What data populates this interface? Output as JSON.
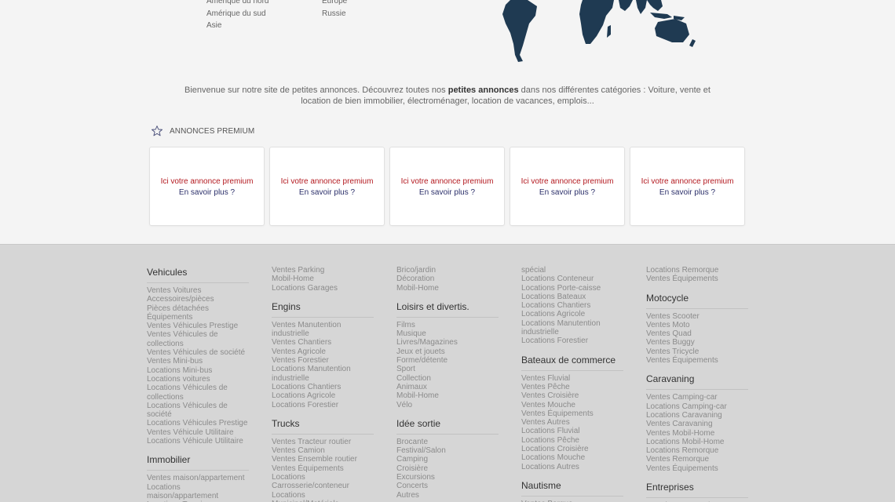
{
  "regions": {
    "col1": [
      "Amérique du nord",
      "Amérique du sud",
      "Asie"
    ],
    "col2": [
      "Europe",
      "Russie"
    ]
  },
  "map": {
    "color": "#1f3a52"
  },
  "welcome": {
    "before": "Bienvenue sur notre site de petites annonces. Découvrez toutes nos ",
    "bold": "petites annonces",
    "after": " dans nos différentes catégories : Voiture, vente et location de bien immobilier, électroménager, location de vacances, emplois..."
  },
  "premium": {
    "title": "ANNONCES PREMIUM",
    "cards": [
      {
        "line1": "Ici votre annonce premium",
        "line2": "En savoir plus ?"
      },
      {
        "line1": "Ici votre annonce premium",
        "line2": "En savoir plus ?"
      },
      {
        "line1": "Ici votre annonce premium",
        "line2": "En savoir plus ?"
      },
      {
        "line1": "Ici votre annonce premium",
        "line2": "En savoir plus ?"
      },
      {
        "line1": "Ici votre annonce premium",
        "line2": "En savoir plus ?"
      }
    ]
  },
  "footer": {
    "columns": [
      [
        {
          "type": "h",
          "text": "Vehicules"
        },
        {
          "type": "i",
          "text": "Ventes Voitures"
        },
        {
          "type": "i",
          "text": "Accessoires/pièces"
        },
        {
          "type": "i",
          "text": "Pièces détachées"
        },
        {
          "type": "i",
          "text": "Équipements"
        },
        {
          "type": "i",
          "text": "Ventes Véhicules Prestige"
        },
        {
          "type": "i",
          "text": "Ventes Véhicules de"
        },
        {
          "type": "i",
          "text": "collections"
        },
        {
          "type": "i",
          "text": "Ventes Véhicules de société"
        },
        {
          "type": "i",
          "text": "Ventes Mini-bus"
        },
        {
          "type": "i",
          "text": "Locations Mini-bus"
        },
        {
          "type": "i",
          "text": "Locations voitures"
        },
        {
          "type": "i",
          "text": "Locations Véhicules de"
        },
        {
          "type": "i",
          "text": "collections"
        },
        {
          "type": "i",
          "text": "Locations Véhicules de société"
        },
        {
          "type": "i",
          "text": "Locations Véhicules Prestige"
        },
        {
          "type": "i",
          "text": "Ventes Véhicule Utilitaire"
        },
        {
          "type": "i",
          "text": "Locations Véhicule Utilitaire"
        },
        {
          "type": "h",
          "text": "Immobilier"
        },
        {
          "type": "i",
          "text": "Ventes maison/appartement"
        },
        {
          "type": "i",
          "text": "Locations"
        },
        {
          "type": "i",
          "text": "maison/appartement"
        },
        {
          "type": "i",
          "text": "Locations Terrains"
        },
        {
          "type": "i",
          "text": "Locations de vacances"
        }
      ],
      [
        {
          "type": "i",
          "text": "Ventes Parking"
        },
        {
          "type": "i",
          "text": "Mobil-Home"
        },
        {
          "type": "i",
          "text": "Locations Garages"
        },
        {
          "type": "h",
          "text": "Engins"
        },
        {
          "type": "i",
          "text": "Ventes Manutention"
        },
        {
          "type": "i",
          "text": "industrielle"
        },
        {
          "type": "i",
          "text": "Ventes Chantiers"
        },
        {
          "type": "i",
          "text": "Ventes Agricole"
        },
        {
          "type": "i",
          "text": "Ventes Forestier"
        },
        {
          "type": "i",
          "text": "Locations Manutention"
        },
        {
          "type": "i",
          "text": "industrielle"
        },
        {
          "type": "i",
          "text": "Locations Chantiers"
        },
        {
          "type": "i",
          "text": "Locations Agricole"
        },
        {
          "type": "i",
          "text": "Locations Forestier"
        },
        {
          "type": "h",
          "text": "Trucks"
        },
        {
          "type": "i",
          "text": "Ventes Tracteur routier"
        },
        {
          "type": "i",
          "text": "Ventes Camion"
        },
        {
          "type": "i",
          "text": "Ventes Ensemble routier"
        },
        {
          "type": "i",
          "text": "Ventes Équipements"
        },
        {
          "type": "i",
          "text": "Locations"
        },
        {
          "type": "i",
          "text": "Carrosserie/conteneur"
        },
        {
          "type": "i",
          "text": "Locations Municipal/Matériels"
        },
        {
          "type": "i",
          "text": "spécial"
        }
      ],
      [
        {
          "type": "i",
          "text": "Brico/jardin"
        },
        {
          "type": "i",
          "text": "Décoration"
        },
        {
          "type": "i",
          "text": "Mobil-Home"
        },
        {
          "type": "h",
          "text": "Loisirs et divertis."
        },
        {
          "type": "i",
          "text": "Films"
        },
        {
          "type": "i",
          "text": "Musique"
        },
        {
          "type": "i",
          "text": "Livres/Magazines"
        },
        {
          "type": "i",
          "text": "Jeux et jouets"
        },
        {
          "type": "i",
          "text": "Forme/détente"
        },
        {
          "type": "i",
          "text": "Sport"
        },
        {
          "type": "i",
          "text": "Collection"
        },
        {
          "type": "i",
          "text": "Animaux"
        },
        {
          "type": "i",
          "text": "Mobil-Home"
        },
        {
          "type": "i",
          "text": "Vélo"
        },
        {
          "type": "h",
          "text": "Idée sortie"
        },
        {
          "type": "i",
          "text": "Brocante"
        },
        {
          "type": "i",
          "text": "Festival/Salon"
        },
        {
          "type": "i",
          "text": "Camping"
        },
        {
          "type": "i",
          "text": "Croisière"
        },
        {
          "type": "i",
          "text": "Excursions"
        },
        {
          "type": "i",
          "text": "Concerts"
        },
        {
          "type": "i",
          "text": "Autres"
        }
      ],
      [
        {
          "type": "i",
          "text": "spécial"
        },
        {
          "type": "i",
          "text": "Locations Conteneur"
        },
        {
          "type": "i",
          "text": "Locations Porte-caisse"
        },
        {
          "type": "i",
          "text": "Locations Bateaux"
        },
        {
          "type": "i",
          "text": "Locations Chantiers"
        },
        {
          "type": "i",
          "text": "Locations Agricole"
        },
        {
          "type": "i",
          "text": "Locations Manutention"
        },
        {
          "type": "i",
          "text": "industrielle"
        },
        {
          "type": "i",
          "text": "Locations Forestier"
        },
        {
          "type": "h",
          "text": "Bateaux de commerce"
        },
        {
          "type": "i",
          "text": "Ventes Fluvial"
        },
        {
          "type": "i",
          "text": "Ventes Pêche"
        },
        {
          "type": "i",
          "text": "Ventes Croisière"
        },
        {
          "type": "i",
          "text": "Ventes Mouche"
        },
        {
          "type": "i",
          "text": "Ventes Équipements"
        },
        {
          "type": "i",
          "text": "Ventes Autres"
        },
        {
          "type": "i",
          "text": "Locations Fluvial"
        },
        {
          "type": "i",
          "text": "Locations Pêche"
        },
        {
          "type": "i",
          "text": "Locations Croisière"
        },
        {
          "type": "i",
          "text": "Locations Mouche"
        },
        {
          "type": "i",
          "text": "Locations Autres"
        },
        {
          "type": "h",
          "text": "Nautisme"
        },
        {
          "type": "i",
          "text": "Ventes Barque"
        }
      ],
      [
        {
          "type": "i",
          "text": "Locations Remorque"
        },
        {
          "type": "i",
          "text": "Ventes Équipements"
        },
        {
          "type": "h",
          "text": "Motocycle"
        },
        {
          "type": "i",
          "text": "Ventes Scooter"
        },
        {
          "type": "i",
          "text": "Ventes Moto"
        },
        {
          "type": "i",
          "text": "Ventes Quad"
        },
        {
          "type": "i",
          "text": "Ventes Buggy"
        },
        {
          "type": "i",
          "text": "Ventes Tricycle"
        },
        {
          "type": "i",
          "text": "Ventes Équipements"
        },
        {
          "type": "h",
          "text": "Caravaning"
        },
        {
          "type": "i",
          "text": "Ventes Camping-car"
        },
        {
          "type": "i",
          "text": "Locations Camping-car"
        },
        {
          "type": "i",
          "text": "Locations Caravaning"
        },
        {
          "type": "i",
          "text": "Ventes Caravaning"
        },
        {
          "type": "i",
          "text": "Ventes Mobil-Home"
        },
        {
          "type": "i",
          "text": "Locations Mobil-Home"
        },
        {
          "type": "i",
          "text": "Locations Remorque"
        },
        {
          "type": "i",
          "text": "Ventes Remorque"
        },
        {
          "type": "i",
          "text": "Ventes Équipements"
        },
        {
          "type": "h",
          "text": "Entreprises"
        },
        {
          "type": "i",
          "text": "Locations Bureau/commerce"
        }
      ]
    ]
  }
}
